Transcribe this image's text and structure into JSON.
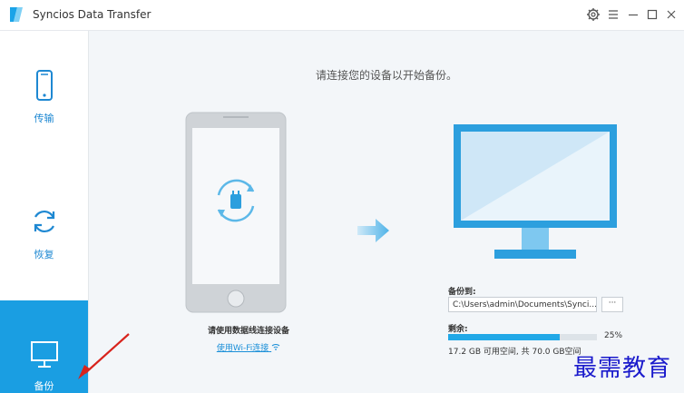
{
  "window": {
    "title": "Syncios Data Transfer",
    "controls": [
      "gear-icon",
      "menu-icon",
      "minimize-icon",
      "maximize-icon",
      "close-icon"
    ]
  },
  "sidebar": {
    "items": [
      {
        "label": "传输",
        "icon": "phone-icon"
      },
      {
        "label": "恢复",
        "icon": "refresh-icon"
      },
      {
        "label": "备份",
        "icon": "monitor-icon",
        "active": true
      }
    ]
  },
  "main": {
    "prompt": "请连接您的设备以开始备份。",
    "cable_tip": "请使用数据线连接设备",
    "wifi_link": "使用Wi-Fi连接"
  },
  "backup": {
    "label": "备份到:",
    "path": "C:\\Users\\admin\\Documents\\Synci...",
    "browse_label": "···",
    "remaining_label": "剩余:",
    "progress": 0.75,
    "percent_text": "25%",
    "space_text": "17.2 GB 可用空间, 共 70.0 GB空间"
  },
  "watermark": "最需教育",
  "colors": {
    "accent": "#1a9ee2",
    "progress": "#21a8e7",
    "monitor_frame": "#2c9fde"
  }
}
